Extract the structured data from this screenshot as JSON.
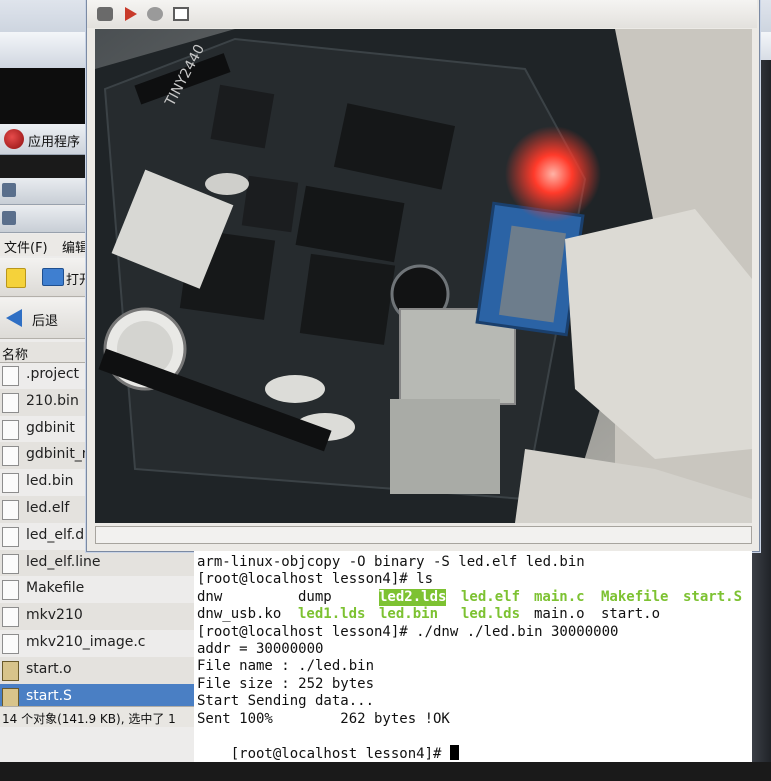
{
  "panel": {
    "label": "应用程序"
  },
  "file_manager": {
    "menu": {
      "file": "文件(F)",
      "edit": "编辑"
    },
    "toolbar": {
      "open": "打开"
    },
    "nav": {
      "back": "后退"
    },
    "column_header": "名称",
    "files": [
      {
        "name": ".project"
      },
      {
        "name": "210.bin"
      },
      {
        "name": "gdbinit"
      },
      {
        "name": "gdbinit_m"
      },
      {
        "name": "led.bin"
      },
      {
        "name": "led.elf"
      },
      {
        "name": "led_elf.di"
      },
      {
        "name": "led_elf.line"
      },
      {
        "name": "Makefile"
      },
      {
        "name": "mkv210"
      },
      {
        "name": "mkv210_image.c"
      },
      {
        "name": "start.o"
      },
      {
        "name": "start.S",
        "selected": true
      }
    ],
    "status": "14 个对象(141.9 KB), 选中了 1"
  },
  "camera": {
    "tools": [
      "snapshot-icon",
      "play-icon",
      "stop-icon",
      "fit-icon"
    ],
    "board_label": "TINY2440"
  },
  "terminal": {
    "lines": [
      "arm-linux-objcopy -O binary -S led.elf led.bin",
      "[root@localhost lesson4]# ls",
      "",
      "",
      "[root@localhost lesson4]# ./dnw ./led.bin 30000000",
      "addr = 30000000",
      "File name : ./led.bin",
      "File size : 252 bytes",
      "Start Sending data...",
      "Sent 100%        262 bytes !OK",
      "[root@localhost lesson4]# "
    ],
    "ls_row1": [
      "dnw",
      "dump",
      "led2.lds",
      "led.elf",
      "main.c",
      "Makefile",
      "start.S"
    ],
    "ls_row2": [
      "dnw_usb.ko",
      "led1.lds",
      "led.bin",
      "led.lds",
      "main.o",
      "start.o"
    ]
  }
}
